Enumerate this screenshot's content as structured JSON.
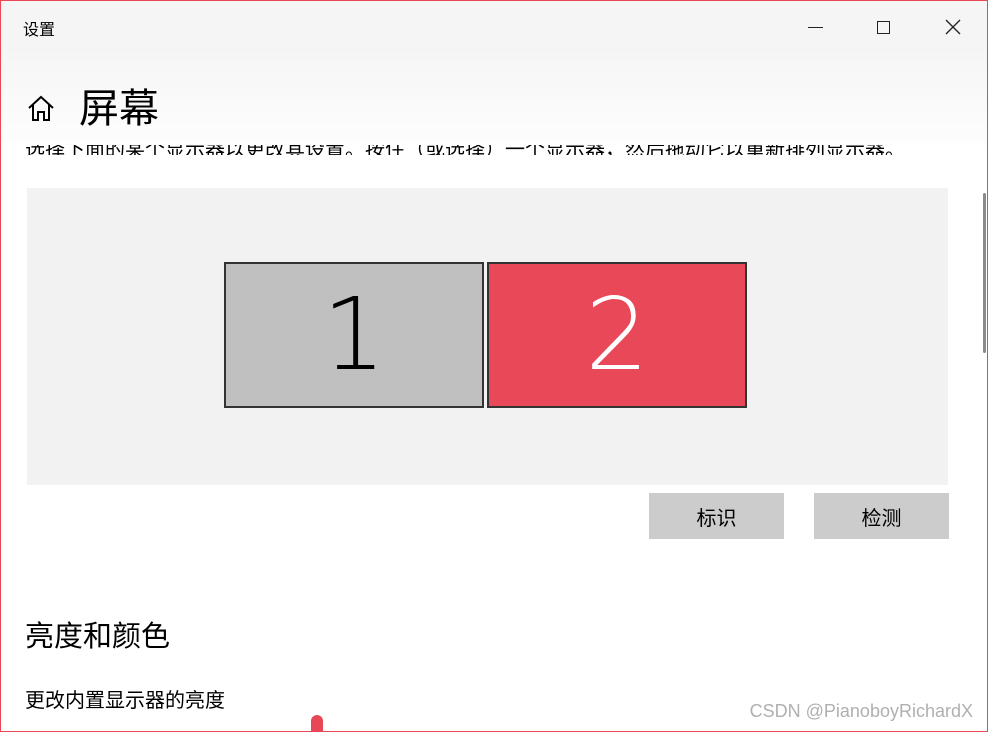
{
  "window": {
    "title": "设置",
    "controls": {
      "minimize": "minimize-icon",
      "maximize": "maximize-icon",
      "close": "close-icon"
    }
  },
  "header": {
    "icon": "home-icon",
    "title": "屏幕"
  },
  "arrangement": {
    "clipped_description": "选择下面的某个显示器以更改其设置。按住（或选择）一个显示器，然后拖动它以重新排列显示器。",
    "monitors": [
      {
        "label": "1",
        "color": "#c0c0c0",
        "selected": false
      },
      {
        "label": "2",
        "color": "#e84857",
        "selected": true
      }
    ],
    "identify_label": "标识",
    "detect_label": "检测"
  },
  "brightness": {
    "section_title": "亮度和颜色",
    "label": "更改内置显示器的亮度",
    "accent": "#e84855"
  },
  "watermark": "CSDN @PianoboyRichardX"
}
